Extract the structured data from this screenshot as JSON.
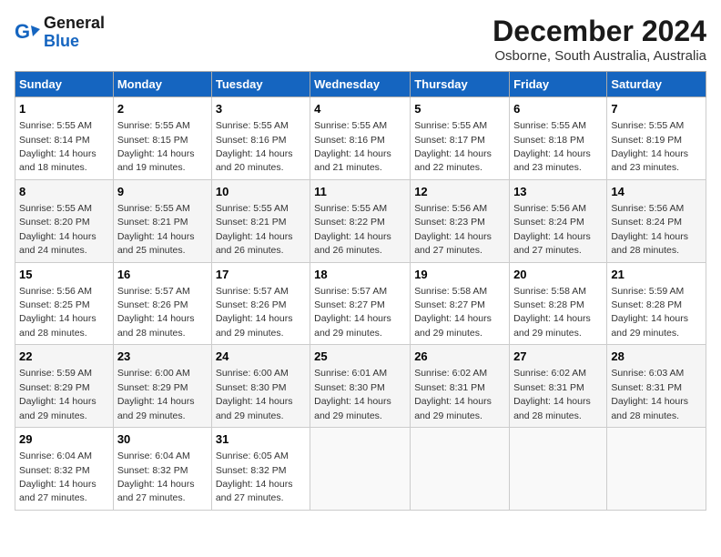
{
  "logo": {
    "line1": "General",
    "line2": "Blue"
  },
  "title": "December 2024",
  "location": "Osborne, South Australia, Australia",
  "headers": [
    "Sunday",
    "Monday",
    "Tuesday",
    "Wednesday",
    "Thursday",
    "Friday",
    "Saturday"
  ],
  "weeks": [
    [
      {
        "day": "1",
        "rise": "5:55 AM",
        "set": "8:14 PM",
        "daylight": "14 hours and 18 minutes."
      },
      {
        "day": "2",
        "rise": "5:55 AM",
        "set": "8:15 PM",
        "daylight": "14 hours and 19 minutes."
      },
      {
        "day": "3",
        "rise": "5:55 AM",
        "set": "8:16 PM",
        "daylight": "14 hours and 20 minutes."
      },
      {
        "day": "4",
        "rise": "5:55 AM",
        "set": "8:16 PM",
        "daylight": "14 hours and 21 minutes."
      },
      {
        "day": "5",
        "rise": "5:55 AM",
        "set": "8:17 PM",
        "daylight": "14 hours and 22 minutes."
      },
      {
        "day": "6",
        "rise": "5:55 AM",
        "set": "8:18 PM",
        "daylight": "14 hours and 23 minutes."
      },
      {
        "day": "7",
        "rise": "5:55 AM",
        "set": "8:19 PM",
        "daylight": "14 hours and 23 minutes."
      }
    ],
    [
      {
        "day": "8",
        "rise": "5:55 AM",
        "set": "8:20 PM",
        "daylight": "14 hours and 24 minutes."
      },
      {
        "day": "9",
        "rise": "5:55 AM",
        "set": "8:21 PM",
        "daylight": "14 hours and 25 minutes."
      },
      {
        "day": "10",
        "rise": "5:55 AM",
        "set": "8:21 PM",
        "daylight": "14 hours and 26 minutes."
      },
      {
        "day": "11",
        "rise": "5:55 AM",
        "set": "8:22 PM",
        "daylight": "14 hours and 26 minutes."
      },
      {
        "day": "12",
        "rise": "5:56 AM",
        "set": "8:23 PM",
        "daylight": "14 hours and 27 minutes."
      },
      {
        "day": "13",
        "rise": "5:56 AM",
        "set": "8:24 PM",
        "daylight": "14 hours and 27 minutes."
      },
      {
        "day": "14",
        "rise": "5:56 AM",
        "set": "8:24 PM",
        "daylight": "14 hours and 28 minutes."
      }
    ],
    [
      {
        "day": "15",
        "rise": "5:56 AM",
        "set": "8:25 PM",
        "daylight": "14 hours and 28 minutes."
      },
      {
        "day": "16",
        "rise": "5:57 AM",
        "set": "8:26 PM",
        "daylight": "14 hours and 28 minutes."
      },
      {
        "day": "17",
        "rise": "5:57 AM",
        "set": "8:26 PM",
        "daylight": "14 hours and 29 minutes."
      },
      {
        "day": "18",
        "rise": "5:57 AM",
        "set": "8:27 PM",
        "daylight": "14 hours and 29 minutes."
      },
      {
        "day": "19",
        "rise": "5:58 AM",
        "set": "8:27 PM",
        "daylight": "14 hours and 29 minutes."
      },
      {
        "day": "20",
        "rise": "5:58 AM",
        "set": "8:28 PM",
        "daylight": "14 hours and 29 minutes."
      },
      {
        "day": "21",
        "rise": "5:59 AM",
        "set": "8:28 PM",
        "daylight": "14 hours and 29 minutes."
      }
    ],
    [
      {
        "day": "22",
        "rise": "5:59 AM",
        "set": "8:29 PM",
        "daylight": "14 hours and 29 minutes."
      },
      {
        "day": "23",
        "rise": "6:00 AM",
        "set": "8:29 PM",
        "daylight": "14 hours and 29 minutes."
      },
      {
        "day": "24",
        "rise": "6:00 AM",
        "set": "8:30 PM",
        "daylight": "14 hours and 29 minutes."
      },
      {
        "day": "25",
        "rise": "6:01 AM",
        "set": "8:30 PM",
        "daylight": "14 hours and 29 minutes."
      },
      {
        "day": "26",
        "rise": "6:02 AM",
        "set": "8:31 PM",
        "daylight": "14 hours and 29 minutes."
      },
      {
        "day": "27",
        "rise": "6:02 AM",
        "set": "8:31 PM",
        "daylight": "14 hours and 28 minutes."
      },
      {
        "day": "28",
        "rise": "6:03 AM",
        "set": "8:31 PM",
        "daylight": "14 hours and 28 minutes."
      }
    ],
    [
      {
        "day": "29",
        "rise": "6:04 AM",
        "set": "8:32 PM",
        "daylight": "14 hours and 27 minutes."
      },
      {
        "day": "30",
        "rise": "6:04 AM",
        "set": "8:32 PM",
        "daylight": "14 hours and 27 minutes."
      },
      {
        "day": "31",
        "rise": "6:05 AM",
        "set": "8:32 PM",
        "daylight": "14 hours and 27 minutes."
      },
      null,
      null,
      null,
      null
    ]
  ]
}
